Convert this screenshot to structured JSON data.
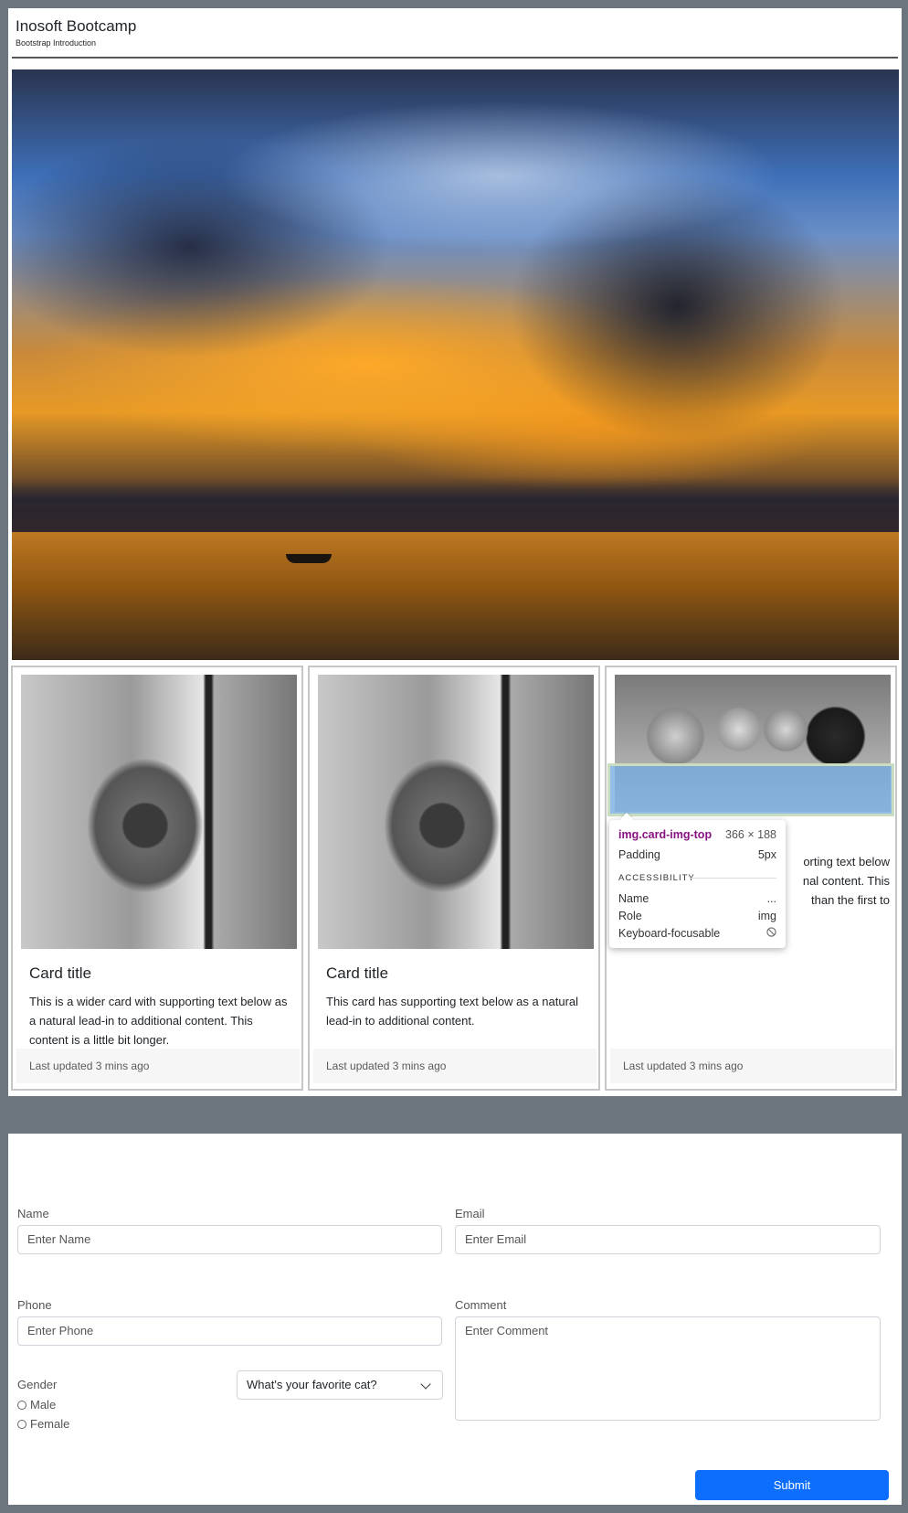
{
  "header": {
    "title": "Inosoft Bootcamp",
    "subtitle": "Bootstrap Introduction"
  },
  "cards": [
    {
      "title": "Card title",
      "text": "This is a wider card with supporting text below as a natural lead-in to additional content. This content is a little bit longer.",
      "footer": "Last updated 3 mins ago"
    },
    {
      "title": "Card title",
      "text": "This card has supporting text below as a natural lead-in to additional content.",
      "footer": "Last updated 3 mins ago"
    },
    {
      "text_visible": "orting text below nal content. This than the first to",
      "footer": "Last updated 3 mins ago"
    }
  ],
  "inspector_tooltip": {
    "selector": "img.card-img-top",
    "dimensions": "366 × 188",
    "padding_label": "Padding",
    "padding_value": "5px",
    "section": "ACCESSIBILITY",
    "name_label": "Name",
    "name_value": "...",
    "role_label": "Role",
    "role_value": "img",
    "focusable_label": "Keyboard-focusable"
  },
  "form": {
    "name_label": "Name",
    "name_placeholder": "Enter Name",
    "email_label": "Email",
    "email_placeholder": "Enter Email",
    "phone_label": "Phone",
    "phone_placeholder": "Enter Phone",
    "comment_label": "Comment",
    "comment_placeholder": "Enter Comment",
    "gender_label": "Gender",
    "gender_options": [
      "Male",
      "Female"
    ],
    "select_value": "What's your favorite cat?",
    "submit_label": "Submit"
  },
  "colors": {
    "background": "#6c757d",
    "primary": "#0d6efd"
  }
}
